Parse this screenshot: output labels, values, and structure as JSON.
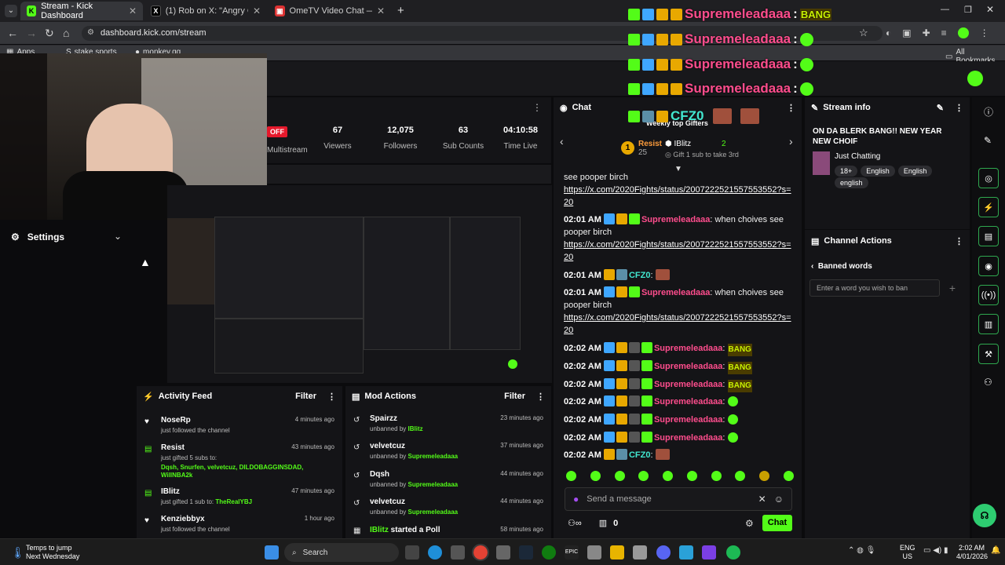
{
  "browser": {
    "tabs": [
      {
        "title": "Stream - Kick Dashboard",
        "active": true
      },
      {
        "title": "(1) Rob on X: \"Angry Chihuahua",
        "active": false
      },
      {
        "title": "OmeTV Video Chat — Omegle",
        "active": false
      }
    ],
    "url": "dashboard.kick.com/stream",
    "bookmarks": [
      "Apps",
      "stake sports",
      "monkey.gg"
    ],
    "all_bookmarks": "All Bookmarks"
  },
  "overlay": {
    "gifter_name": "Supremeleadaaa",
    "sep": ":",
    "bang": "BANG"
  },
  "stats": [
    {
      "value": "",
      "label": "Multistream",
      "badge": "OFF"
    },
    {
      "value": "67",
      "label": "Viewers"
    },
    {
      "value": "12,075",
      "label": "Followers"
    },
    {
      "value": "63",
      "label": "Sub Counts"
    },
    {
      "value": "04:10:58",
      "label": "Time Live"
    }
  ],
  "settings": {
    "label": "Settings"
  },
  "activity_feed": {
    "title": "Activity Feed",
    "filter": "Filter",
    "items": [
      {
        "name": "NoseRp",
        "desc": "just followed the channel",
        "time": "4 minutes ago"
      },
      {
        "name": "Resist",
        "desc": "just gifted 5 subs to:",
        "time": "43 minutes ago",
        "recipients": "Dqsh, Snurfen, velvetcuz, DILDOBAGGINSDAD, WillNBA2k"
      },
      {
        "name": "IBlitz",
        "desc": "just gifted 1 sub to:",
        "time": "47 minutes ago",
        "recipients": "TheRealYBJ"
      },
      {
        "name": "Kenziebbyx",
        "desc": "just followed the channel",
        "time": "1 hour ago"
      }
    ]
  },
  "mod_actions": {
    "title": "Mod Actions",
    "filter": "Filter",
    "items": [
      {
        "name": "Spairzz",
        "desc": "unbanned by",
        "by": "IBlitz",
        "time": "23 minutes ago"
      },
      {
        "name": "velvetcuz",
        "desc": "unbanned by",
        "by": "Supremeleadaaa",
        "time": "37 minutes ago"
      },
      {
        "name": "Dqsh",
        "desc": "unbanned by",
        "by": "Supremeleadaaa",
        "time": "44 minutes ago"
      },
      {
        "name": "velvetcuz",
        "desc": "unbanned by",
        "by": "Supremeleadaaa",
        "time": "44 minutes ago"
      },
      {
        "name": "IBlitz",
        "desc": "started a Poll",
        "time": "58 minutes ago"
      }
    ]
  },
  "chat": {
    "title": "Chat",
    "top_gifter": "CFZ0",
    "weekly": "Weekly top Gifters",
    "rank1": {
      "name": "Resist",
      "count": "25"
    },
    "rank2": {
      "name": "IBlitz",
      "count": "2"
    },
    "gift_hint": "Gift 1 sub to take 3rd",
    "msg_top": "see pooper birch",
    "link": "https://x.com/2020Fights/status/2007222521557553552?s=20",
    "messages": [
      {
        "time": "02:01 AM",
        "user": "Supremeleadaaa",
        "text": "when choives see pooper birch"
      },
      {
        "time": "02:01 AM",
        "user": "CFZ0",
        "text": ""
      },
      {
        "time": "02:01 AM",
        "user": "Supremeleadaaa",
        "text": "when choives see pooper birch"
      },
      {
        "time": "02:02 AM",
        "user": "Supremeleadaaa"
      },
      {
        "time": "02:02 AM",
        "user": "Supremeleadaaa"
      },
      {
        "time": "02:02 AM",
        "user": "Supremeleadaaa"
      },
      {
        "time": "02:02 AM",
        "user": "Supremeleadaaa"
      },
      {
        "time": "02:02 AM",
        "user": "Supremeleadaaa"
      },
      {
        "time": "02:02 AM",
        "user": "Supremeleadaaa"
      },
      {
        "time": "02:02 AM",
        "user": "CFZ0"
      }
    ],
    "placeholder": "Send a message",
    "points": "0",
    "send": "Chat"
  },
  "stream_info": {
    "title": "Stream info",
    "stream_title": "ON DA BLERK BANG!! NEW YEAR NEW CHOIF",
    "category": "Just Chatting",
    "tags": [
      "18+",
      "English",
      "English",
      "english"
    ]
  },
  "channel_actions": {
    "title": "Channel Actions",
    "banned": "Banned words",
    "placeholder": "Enter a word you wish to ban"
  },
  "taskbar": {
    "weather": "Temps to jump",
    "weather_sub": "Next Wednesday",
    "search": "Search",
    "lang": "ENG",
    "region": "US",
    "time": "2:02 AM",
    "date": "4/01/2026"
  },
  "colors": {
    "accent": "#53fc18",
    "pink": "#ff4d8d",
    "teal": "#42e8d0"
  }
}
